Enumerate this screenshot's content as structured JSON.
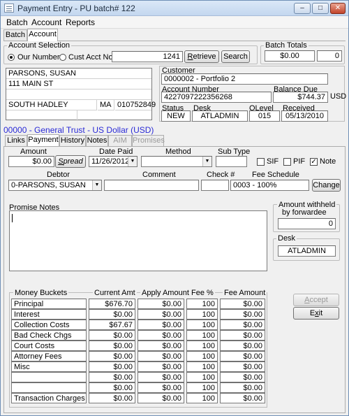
{
  "window": {
    "title": "Payment Entry - PU batch# 122",
    "min": "–",
    "max": "□",
    "close": "✕"
  },
  "menu": [
    "Batch",
    "Account",
    "Reports"
  ],
  "outer_tabs": [
    {
      "label": "Batch"
    },
    {
      "label": "Account"
    }
  ],
  "account_selection": {
    "legend": "Account Selection",
    "our_number_label": "Our Number",
    "cust_acct_label": "Cust Acct No",
    "number_value": "1241",
    "retrieve_label": "Retrieve",
    "search_label": "Search"
  },
  "batch_totals": {
    "legend": "Batch Totals",
    "amount": "$0.00",
    "count": "0"
  },
  "address": {
    "name": "PARSONS, SUSAN",
    "street": "111 MAIN ST",
    "line3": "",
    "city": "SOUTH HADLEY",
    "state": "MA",
    "zip": "010752849"
  },
  "customer": {
    "label": "Customer",
    "value": "0000002 - Portfolio 2",
    "account_number_label": "Account Number",
    "account_number": "4227097222356268",
    "balance_due_label": "Balance Due",
    "balance_due": "$744.37",
    "currency": "USD",
    "status_label": "Status",
    "status": "NEW",
    "desk_label": "Desk",
    "desk": "ATLADMIN",
    "qlevel_label": "QLevel",
    "qlevel": "015",
    "received_label": "Received",
    "received": "05/13/2010"
  },
  "general_trust": "00000 - General Trust - US Dollar (USD)",
  "inner_tabs": [
    {
      "label": "Links"
    },
    {
      "label": "Payment"
    },
    {
      "label": "History"
    },
    {
      "label": "Notes"
    },
    {
      "label": "AIM"
    },
    {
      "label": "Promises"
    }
  ],
  "payment": {
    "amount_label": "Amount",
    "amount": "$0.00",
    "spread_label": "Spread",
    "date_paid_label": "Date Paid",
    "date_paid": "11/26/2012",
    "method_label": "Method",
    "method": "",
    "subtype_label": "Sub Type",
    "subtype": "",
    "sif_label": "SIF",
    "pif_label": "PIF",
    "note_label": "Note",
    "debtor_label": "Debtor",
    "debtor": "0-PARSONS, SUSAN",
    "comment_label": "Comment",
    "comment": "",
    "check_label": "Check #",
    "check": "",
    "fee_schedule_label": "Fee Schedule",
    "fee_schedule": "0003 - 100%",
    "change_label": "Change",
    "promise_notes_label": "Promise Notes",
    "withheld_label_1": "Amount withheld",
    "withheld_label_2": "by forwardee",
    "withheld_value": "0",
    "desk_legend": "Desk",
    "desk_value": "ATLADMIN"
  },
  "buckets": {
    "headers": {
      "bucket": "Money Buckets",
      "current": "Current Amt",
      "apply": "Apply Amount",
      "fee_pct": "Fee %",
      "fee_amt": "Fee Amount"
    },
    "rows": [
      {
        "name": "Principal",
        "current": "$676.70",
        "apply": "$0.00",
        "fee_pct": "100",
        "fee_amt": "$0.00"
      },
      {
        "name": "Interest",
        "current": "$0.00",
        "apply": "$0.00",
        "fee_pct": "100",
        "fee_amt": "$0.00"
      },
      {
        "name": "Collection Costs",
        "current": "$67.67",
        "apply": "$0.00",
        "fee_pct": "100",
        "fee_amt": "$0.00"
      },
      {
        "name": "Bad Check Chgs",
        "current": "$0.00",
        "apply": "$0.00",
        "fee_pct": "100",
        "fee_amt": "$0.00"
      },
      {
        "name": "Court Costs",
        "current": "$0.00",
        "apply": "$0.00",
        "fee_pct": "100",
        "fee_amt": "$0.00"
      },
      {
        "name": "Attorney Fees",
        "current": "$0.00",
        "apply": "$0.00",
        "fee_pct": "100",
        "fee_amt": "$0.00"
      },
      {
        "name": "Misc",
        "current": "$0.00",
        "apply": "$0.00",
        "fee_pct": "100",
        "fee_amt": "$0.00"
      },
      {
        "name": "",
        "current": "$0.00",
        "apply": "$0.00",
        "fee_pct": "100",
        "fee_amt": "$0.00"
      },
      {
        "name": "",
        "current": "$0.00",
        "apply": "$0.00",
        "fee_pct": "100",
        "fee_amt": "$0.00"
      },
      {
        "name": "Transaction Charges",
        "current": "$0.00",
        "apply": "$0.00",
        "fee_pct": "100",
        "fee_amt": "$0.00"
      }
    ]
  },
  "actions": {
    "accept_label": "Accept",
    "exit_label": "Exit"
  }
}
